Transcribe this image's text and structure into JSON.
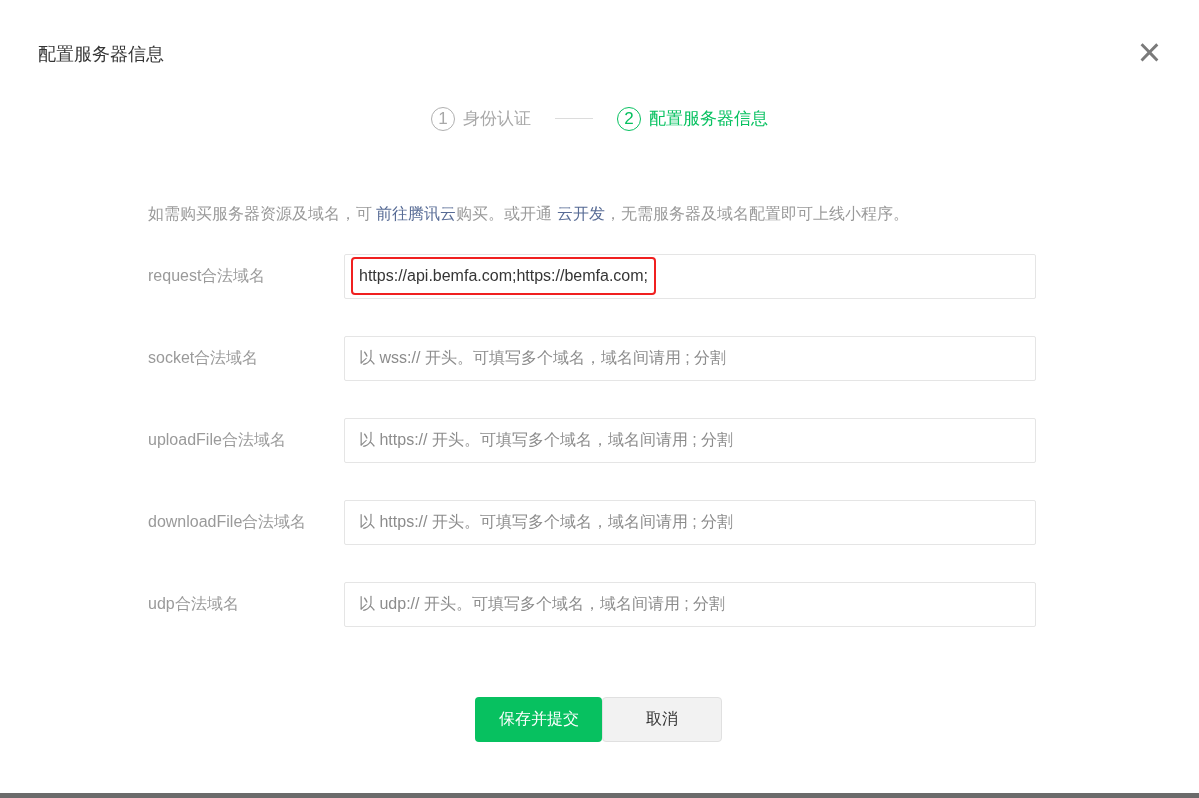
{
  "dialog": {
    "title": "配置服务器信息",
    "close": "×"
  },
  "steps": [
    {
      "number": "1",
      "label": "身份认证",
      "selected": false
    },
    {
      "number": "2",
      "label": "配置服务器信息",
      "selected": true
    }
  ],
  "notice": [
    {
      "kind": "text",
      "text": "如需购买服务器资源及域名，可 "
    },
    {
      "kind": "link",
      "text": "前往腾讯云"
    },
    {
      "kind": "text",
      "text": "购买。或开通 "
    },
    {
      "kind": "link",
      "text": "云开发"
    },
    {
      "kind": "text",
      "text": "，无需服务器及域名配置即可上线小程序。"
    }
  ],
  "fields": [
    {
      "label": "request合法域名",
      "value": "https://api.bemfa.com;https://bemfa.com;",
      "highlighted": true
    },
    {
      "label": "socket合法域名",
      "placeholder": "以 wss:// 开头。可填写多个域名，域名间请用 ; 分割",
      "highlighted": false
    },
    {
      "label": "uploadFile合法域名",
      "placeholder": "以 https:// 开头。可填写多个域名，域名间请用 ; 分割",
      "highlighted": false
    },
    {
      "label": "downloadFile合法域名",
      "placeholder": "以 https:// 开头。可填写多个域名，域名间请用 ; 分割",
      "highlighted": false
    },
    {
      "label": "udp合法域名",
      "placeholder": "以 udp:// 开头。可填写多个域名，域名间请用 ; 分割",
      "highlighted": false
    }
  ],
  "buttons": [
    {
      "label": "保存并提交",
      "kind": "primary"
    },
    {
      "label": "取消",
      "kind": "secondary"
    }
  ]
}
